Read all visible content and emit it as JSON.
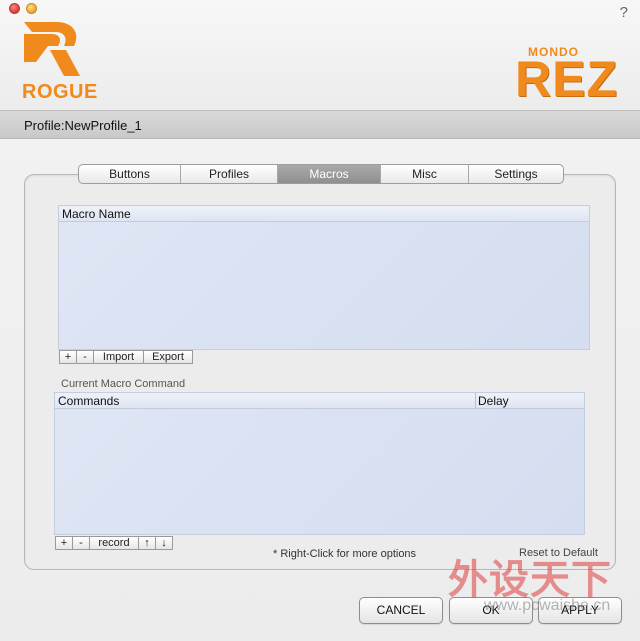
{
  "window": {
    "help_icon": "?",
    "traffic_lights": [
      "close",
      "minimize"
    ]
  },
  "branding": {
    "left_logo_word": "ROGUE",
    "right_logo_small": "MONDO",
    "right_logo_big": "REZ",
    "accent_color": "#f08a1c"
  },
  "profile": {
    "label": "Profile:NewProfile_1"
  },
  "tabs": [
    {
      "label": "Buttons",
      "active": false
    },
    {
      "label": "Profiles",
      "active": false
    },
    {
      "label": "Macros",
      "active": true
    },
    {
      "label": "Misc",
      "active": false
    },
    {
      "label": "Settings",
      "active": false
    }
  ],
  "macro_list": {
    "header": "Macro Name",
    "buttons": {
      "add": "+",
      "remove": "-",
      "import": "Import",
      "export": "Export"
    }
  },
  "command_list": {
    "section_label": "Current Macro Command",
    "columns": [
      "Commands",
      "Delay"
    ],
    "buttons": {
      "add": "+",
      "remove": "-",
      "record": "record",
      "up": "↑",
      "down": "↓"
    }
  },
  "hint": "* Right-Click for more options",
  "reset_default": "Reset to Default",
  "footer": {
    "cancel": "CANCEL",
    "ok": "OK",
    "apply": "APPLY"
  },
  "watermark": {
    "cn": "外设天下",
    "url": "www.pcwaishe.cn"
  }
}
